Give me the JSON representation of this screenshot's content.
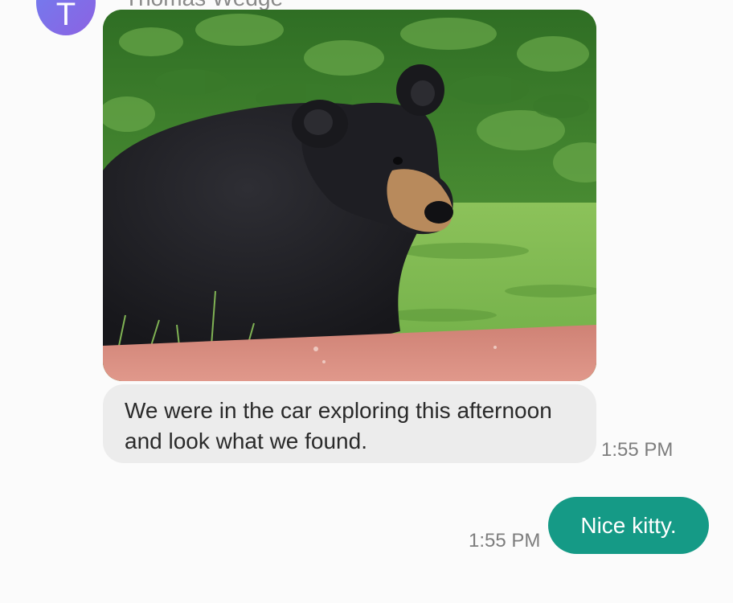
{
  "conversation": {
    "contact": {
      "initial": "T",
      "name": "Thomas Wedge"
    },
    "messages": [
      {
        "direction": "incoming",
        "kind": "image",
        "image_subject": "black bear in grass beside car"
      },
      {
        "direction": "incoming",
        "kind": "text",
        "text": "We were in the car exploring this afternoon and look what we found.",
        "time": "1:55 PM"
      },
      {
        "direction": "outgoing",
        "kind": "text",
        "text": "Nice kitty.",
        "time": "1:55 PM"
      }
    ]
  },
  "colors": {
    "background": "#fbfbfb",
    "incoming_bubble": "#ececec",
    "outgoing_bubble": "#159a86",
    "timestamp": "#7d7d7d",
    "avatar_gradient_start": "#6f7ff0",
    "avatar_gradient_end": "#8c62e2"
  }
}
